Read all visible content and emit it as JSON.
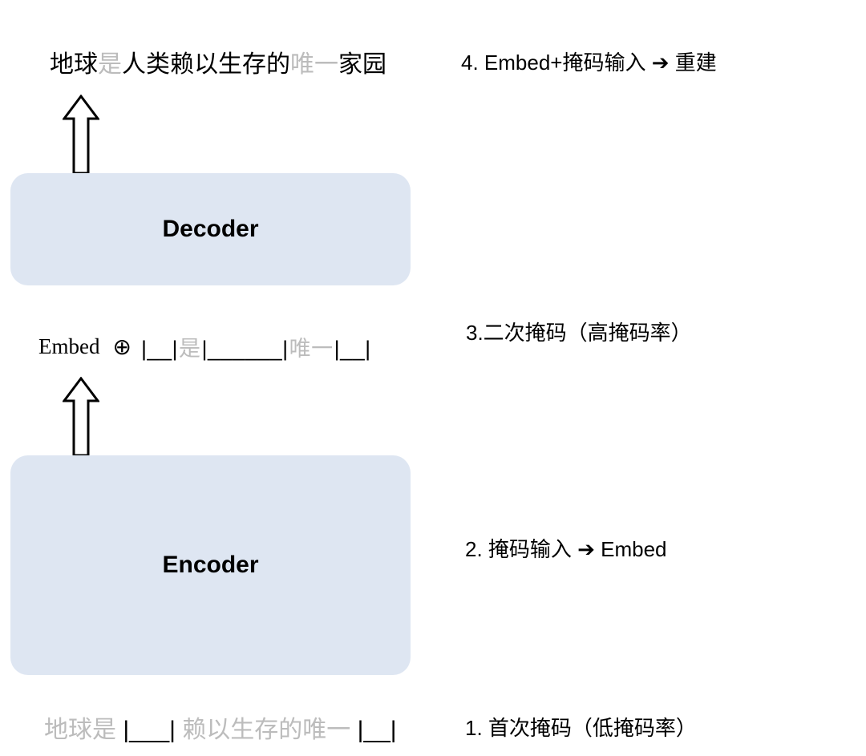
{
  "colors": {
    "box_bg": "#dee6f2",
    "faded_text": "#bcbcbc",
    "text": "#000000"
  },
  "output": {
    "tokens": [
      {
        "t": "地球",
        "faded": false
      },
      {
        "t": "是",
        "faded": true
      },
      {
        "t": "人类赖以生存的",
        "faded": false
      },
      {
        "t": "唯一",
        "faded": true
      },
      {
        "t": "家园",
        "faded": false
      }
    ]
  },
  "decoder": {
    "label": "Decoder"
  },
  "embed_line": {
    "prefix": "Embed",
    "symbol": "⊕",
    "tokens": [
      {
        "t": "|__|",
        "faded": false,
        "blank": true
      },
      {
        "t": "是",
        "faded": true
      },
      {
        "t": "|______|",
        "faded": false,
        "blank": true
      },
      {
        "t": "唯一",
        "faded": true
      },
      {
        "t": "|__|",
        "faded": false,
        "blank": true
      }
    ]
  },
  "encoder": {
    "label": "Encoder"
  },
  "input_line": {
    "tokens": [
      {
        "t": "地球是",
        "faded": true
      },
      {
        "t": " |___| ",
        "faded": false,
        "blank": true
      },
      {
        "t": "赖以生存的唯一",
        "faded": true
      },
      {
        "t": " |__|",
        "faded": false,
        "blank": true
      }
    ]
  },
  "captions": {
    "step4": "4. Embed+掩码输入 ➔ 重建",
    "step3": "3.二次掩码（高掩码率）",
    "step2": "2. 掩码输入 ➔ Embed",
    "step1": "1. 首次掩码（低掩码率）"
  }
}
